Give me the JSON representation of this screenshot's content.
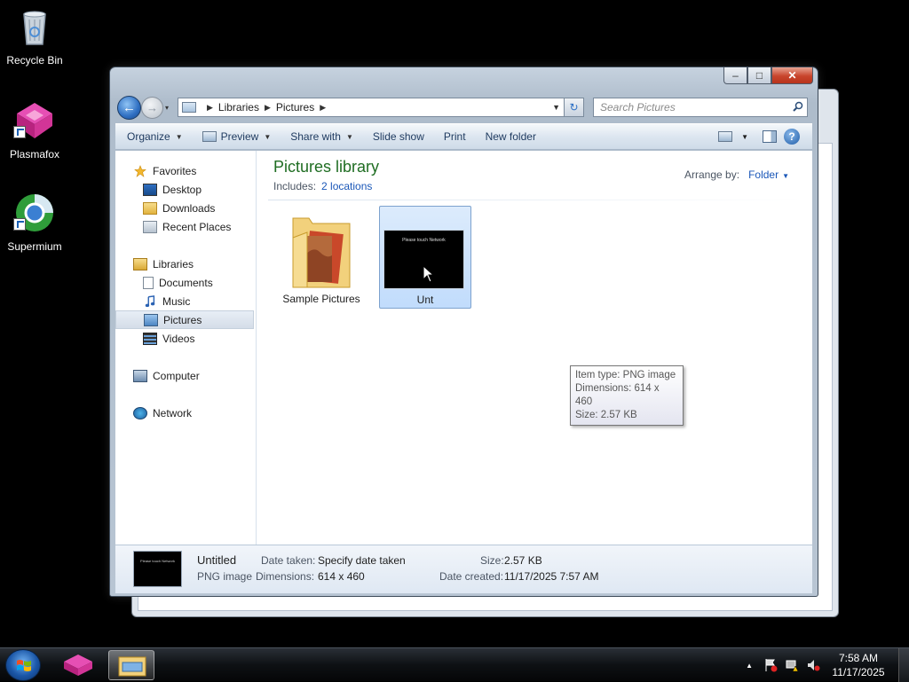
{
  "desktop": {
    "icons": [
      {
        "label": "Recycle Bin"
      },
      {
        "label": "Plasmafox"
      },
      {
        "label": "Supermium"
      }
    ]
  },
  "window": {
    "caption": {
      "minimize": "–",
      "maximize": "□",
      "close": "✕"
    },
    "address": {
      "crumbs": [
        "Libraries",
        "Pictures"
      ]
    },
    "search": {
      "placeholder": "Search Pictures"
    },
    "toolbar": {
      "organize": "Organize",
      "preview": "Preview",
      "share_with": "Share with",
      "slide_show": "Slide show",
      "print": "Print",
      "new_folder": "New folder",
      "help": "?"
    },
    "navpane": {
      "favorites": "Favorites",
      "desktop": "Desktop",
      "downloads": "Downloads",
      "recent_places": "Recent Places",
      "libraries": "Libraries",
      "documents": "Documents",
      "music": "Music",
      "pictures": "Pictures",
      "videos": "Videos",
      "computer": "Computer",
      "network": "Network"
    },
    "library": {
      "title": "Pictures library",
      "includes_label": "Includes:",
      "includes_link": "2 locations",
      "arrange_label": "Arrange by:",
      "arrange_value": "Folder"
    },
    "files": [
      {
        "name": "Sample Pictures"
      },
      {
        "name": "Untitled",
        "visible_name": "Unt",
        "thumb_text": "Please touch Network"
      }
    ],
    "tooltip": {
      "line1": "Item type: PNG image",
      "line2": "Dimensions: 614 x 460",
      "line3": "Size: 2.57 KB"
    },
    "details": {
      "name": "Untitled",
      "type": "PNG image",
      "date_taken_label": "Date taken:",
      "date_taken_value": "Specify date taken",
      "dimensions_label": "Dimensions:",
      "dimensions_value": "614 x 460",
      "size_label": "Size:",
      "size_value": "2.57 KB",
      "date_created_label": "Date created:",
      "date_created_value": "11/17/2025 7:57 AM"
    }
  },
  "taskbar": {
    "clock_time": "7:58 AM",
    "clock_date": "11/17/2025",
    "tray_arrow": "▲"
  },
  "colors": {
    "library_title": "#1f6d22",
    "link": "#1a57b8",
    "selection": "#c1dcfc"
  }
}
